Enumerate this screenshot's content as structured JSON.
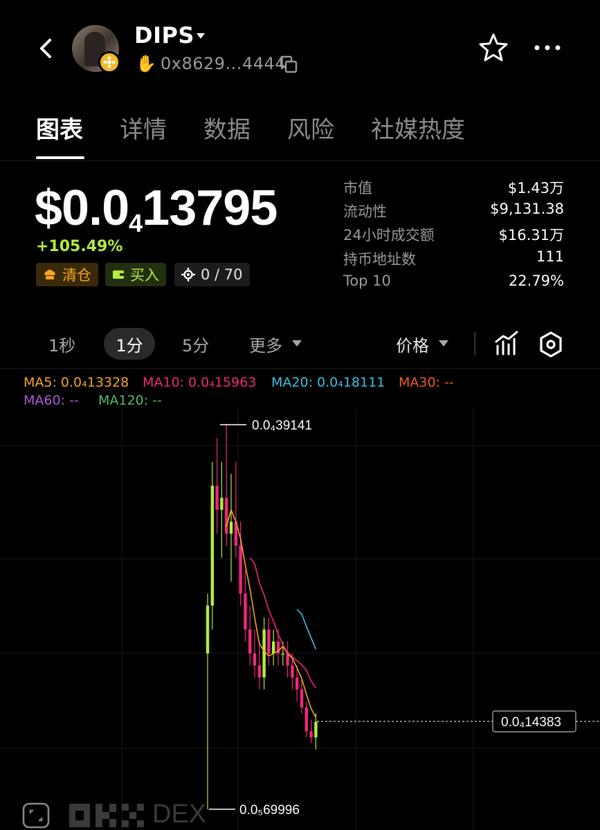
{
  "header": {
    "token_name": "DIPS",
    "address": "0x8629...4444",
    "icons": [
      "back-arrow-icon",
      "bnb-chain-icon",
      "hand-icon",
      "copy-icon",
      "star-icon",
      "more-icon"
    ]
  },
  "tabs": [
    "图表",
    "详情",
    "数据",
    "风险",
    "社媒热度"
  ],
  "price": {
    "main": "$0.0",
    "sub": "4",
    "rest": "13795",
    "change": "+105.49%"
  },
  "actions": {
    "sell": "清仓",
    "buy": "买入",
    "count": "0 / 70"
  },
  "stats": [
    {
      "label": "市值",
      "value": "$1.43万"
    },
    {
      "label": "流动性",
      "value": "$9,131.38"
    },
    {
      "label": "24小时成交额",
      "value": "$16.31万"
    },
    {
      "label": "持币地址数",
      "value": "111"
    },
    {
      "label": "Top 10",
      "value": "22.79%"
    }
  ],
  "intervals": {
    "items": [
      "1秒",
      "1分",
      "5分",
      "更多"
    ],
    "selected": "1分",
    "price_mode": "价格"
  },
  "ma_legend": {
    "ma5": "MA5: 0.0₄13328",
    "ma10": "MA10: 0.0₄15963",
    "ma20": "MA20: 0.0₄18111",
    "ma30": "MA30: --",
    "ma60": "MA60: --",
    "ma120": "MA120: --"
  },
  "chart_labels": {
    "high": "0.0₄39141",
    "low": "0.0₅69996",
    "current": "0.0₄14383"
  },
  "watermark": "DEX",
  "colors": {
    "up": "#b4ed3e",
    "down": "#f0287c",
    "ma5": "#f5a623",
    "ma10": "#f0287c",
    "ma20": "#3ec1e0",
    "ma30": "#f05a28",
    "ma60": "#b05ad6",
    "ma120": "#4fbf6a"
  },
  "chart_data": {
    "type": "candlestick",
    "series_unit": "0.0₄ (×1e-4)",
    "candles": [
      {
        "o": 0.2,
        "h": 0.25,
        "l": 0.07,
        "c": 0.24
      },
      {
        "o": 0.24,
        "h": 0.36,
        "l": 0.22,
        "c": 0.34
      },
      {
        "o": 0.34,
        "h": 0.38,
        "l": 0.3,
        "c": 0.32
      },
      {
        "o": 0.32,
        "h": 0.36,
        "l": 0.28,
        "c": 0.33
      },
      {
        "o": 0.33,
        "h": 0.391,
        "l": 0.29,
        "c": 0.3
      },
      {
        "o": 0.3,
        "h": 0.35,
        "l": 0.26,
        "c": 0.31
      },
      {
        "o": 0.31,
        "h": 0.36,
        "l": 0.28,
        "c": 0.29
      },
      {
        "o": 0.29,
        "h": 0.31,
        "l": 0.24,
        "c": 0.25
      },
      {
        "o": 0.25,
        "h": 0.27,
        "l": 0.21,
        "c": 0.22
      },
      {
        "o": 0.22,
        "h": 0.24,
        "l": 0.19,
        "c": 0.2
      },
      {
        "o": 0.2,
        "h": 0.22,
        "l": 0.18,
        "c": 0.19
      },
      {
        "o": 0.19,
        "h": 0.21,
        "l": 0.17,
        "c": 0.18
      },
      {
        "o": 0.18,
        "h": 0.23,
        "l": 0.17,
        "c": 0.22
      },
      {
        "o": 0.22,
        "h": 0.23,
        "l": 0.19,
        "c": 0.2
      },
      {
        "o": 0.2,
        "h": 0.22,
        "l": 0.19,
        "c": 0.21
      },
      {
        "o": 0.21,
        "h": 0.22,
        "l": 0.19,
        "c": 0.2
      },
      {
        "o": 0.2,
        "h": 0.21,
        "l": 0.19,
        "c": 0.2
      },
      {
        "o": 0.2,
        "h": 0.21,
        "l": 0.18,
        "c": 0.19
      },
      {
        "o": 0.19,
        "h": 0.2,
        "l": 0.17,
        "c": 0.18
      },
      {
        "o": 0.18,
        "h": 0.19,
        "l": 0.16,
        "c": 0.17
      },
      {
        "o": 0.17,
        "h": 0.18,
        "l": 0.15,
        "c": 0.155
      },
      {
        "o": 0.155,
        "h": 0.16,
        "l": 0.13,
        "c": 0.135
      },
      {
        "o": 0.135,
        "h": 0.145,
        "l": 0.125,
        "c": 0.13
      },
      {
        "o": 0.13,
        "h": 0.15,
        "l": 0.12,
        "c": 0.143
      }
    ],
    "ylim": [
      0.06,
      0.4
    ]
  }
}
